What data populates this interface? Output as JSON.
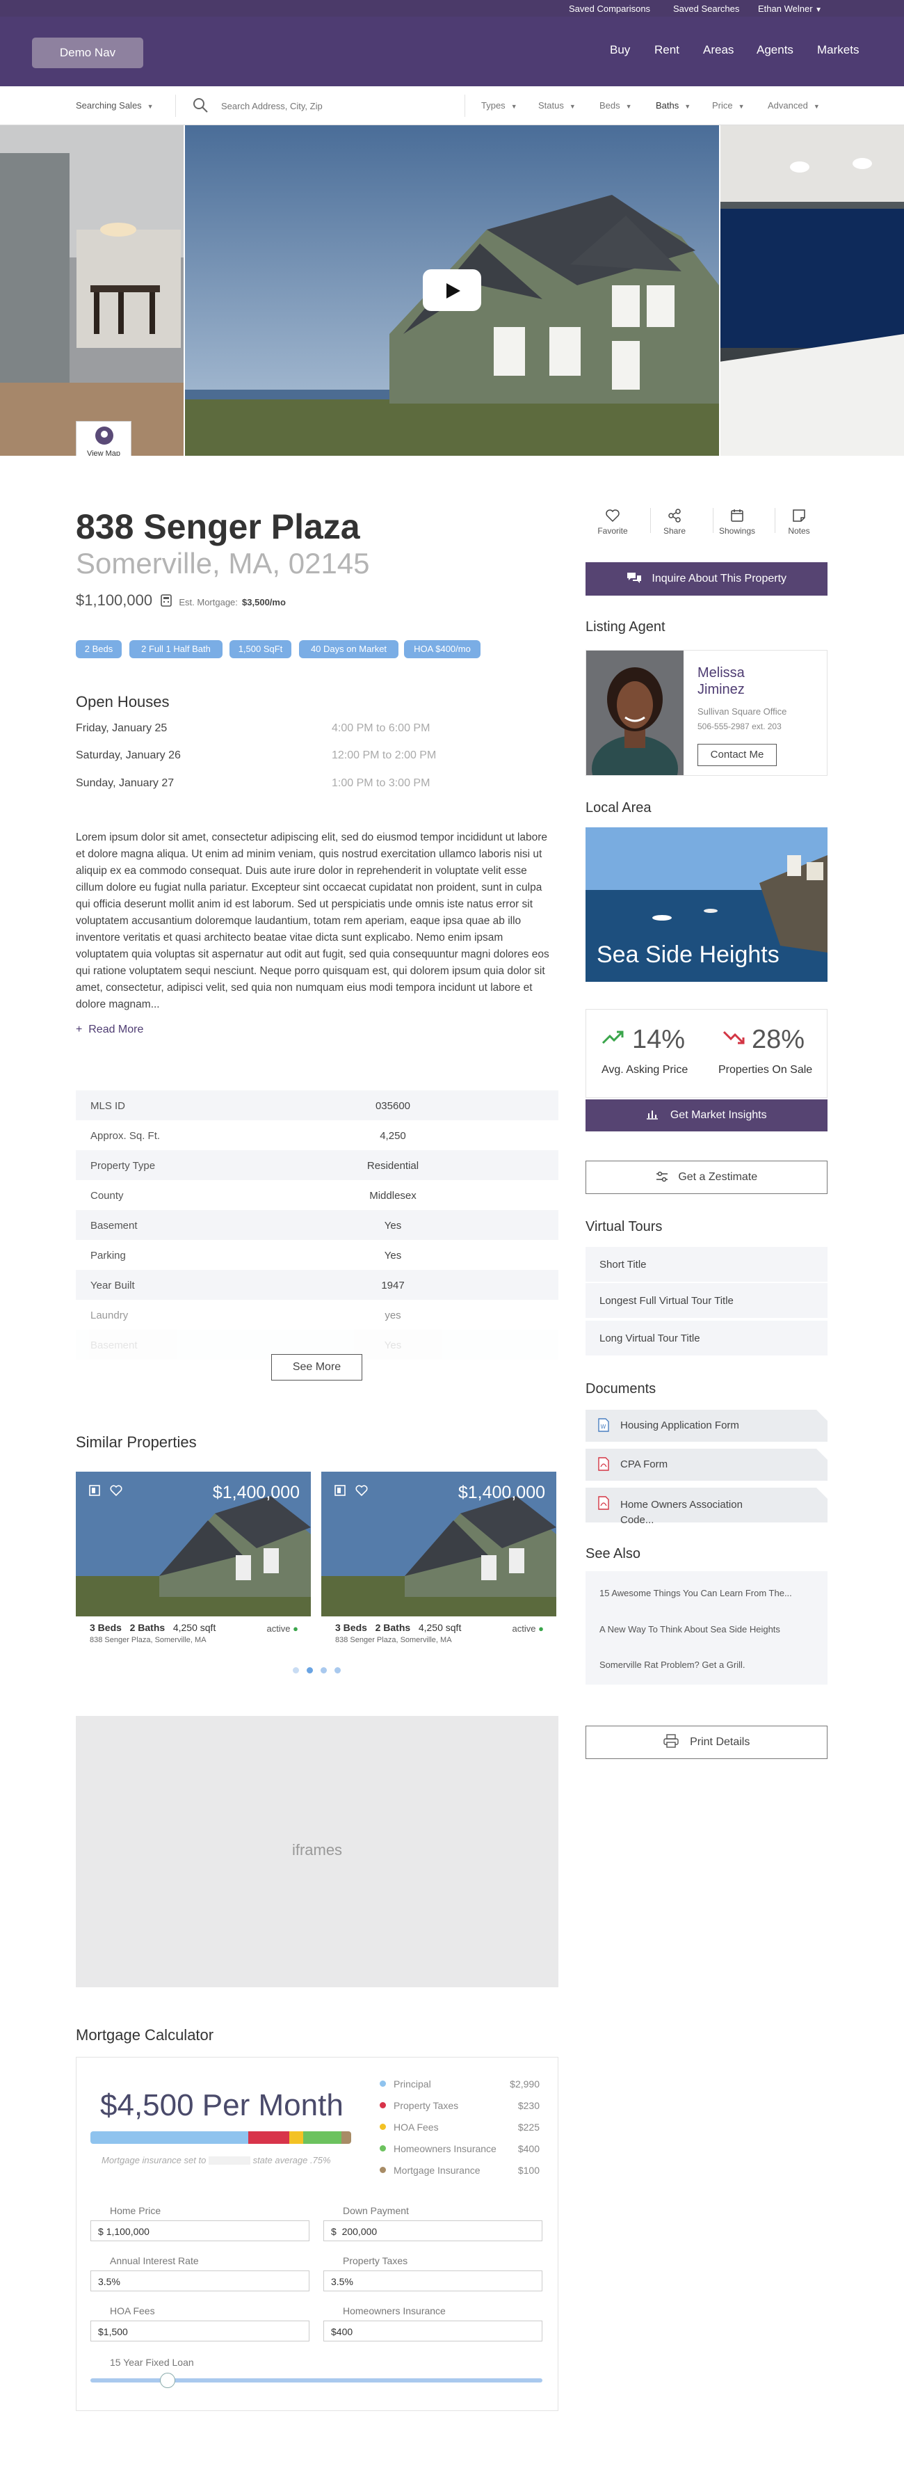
{
  "topbar": {
    "saved_comparisons": "Saved Comparisons",
    "saved_searches": "Saved Searches",
    "user": "Ethan Welner"
  },
  "nav": {
    "demo": "Demo Nav",
    "links": [
      "Buy",
      "Rent",
      "Areas",
      "Agents",
      "Markets"
    ]
  },
  "search": {
    "mode": "Searching Sales",
    "placeholder": "Search Address, City, Zip",
    "filters": [
      "Types",
      "Status",
      "Beds",
      "Baths",
      "Price",
      "Advanced"
    ]
  },
  "hero": {
    "view_map": "View Map"
  },
  "listing": {
    "address": "838 Senger Plaza",
    "location": "Somerville, MA, 02145",
    "price": "$1,100,000",
    "mortgage_label": "Est. Mortgage:",
    "mortgage_value": "$3,500/mo",
    "tags": [
      "2 Beds",
      "2 Full 1 Half Bath",
      "1,500 SqFt",
      "40 Days on Market",
      "HOA $400/mo"
    ]
  },
  "open_houses": {
    "title": "Open Houses",
    "items": [
      {
        "date": "Friday, January 25",
        "time": "4:00 PM to 6:00 PM"
      },
      {
        "date": "Saturday, January 26",
        "time": "12:00 PM to 2:00 PM"
      },
      {
        "date": "Sunday, January 27",
        "time": "1:00 PM to 3:00 PM"
      }
    ]
  },
  "description": "Lorem ipsum dolor sit amet, consectetur adipiscing elit, sed do eiusmod tempor incididunt ut labore et dolore magna aliqua. Ut enim ad minim veniam, quis nostrud exercitation ullamco laboris nisi ut aliquip ex ea commodo consequat. Duis aute irure dolor in reprehenderit in voluptate velit esse cillum dolore eu fugiat nulla pariatur. Excepteur sint occaecat cupidatat non proident, sunt in culpa qui officia deserunt mollit anim id est laborum. Sed ut perspiciatis unde omnis iste natus error sit voluptatem accusantium doloremque laudantium, totam rem aperiam, eaque ipsa quae ab illo inventore veritatis et quasi architecto beatae vitae dicta sunt explicabo. Nemo enim ipsam voluptatem quia voluptas sit aspernatur aut odit aut fugit, sed quia consequuntur magni dolores eos qui ratione voluptatem sequi nesciunt. Neque porro quisquam est, qui dolorem ipsum quia dolor sit amet, consectetur, adipisci velit, sed quia non numquam eius modi tempora incidunt ut labore et dolore magnam...",
  "read_more": "Read More",
  "facts": [
    {
      "k": "MLS ID",
      "v": "035600"
    },
    {
      "k": "Approx. Sq. Ft.",
      "v": "4,250"
    },
    {
      "k": "Property Type",
      "v": "Residential"
    },
    {
      "k": "County",
      "v": "Middlesex"
    },
    {
      "k": "Basement",
      "v": "Yes"
    },
    {
      "k": "Parking",
      "v": "Yes"
    },
    {
      "k": "Year Built",
      "v": "1947"
    },
    {
      "k": "Laundry",
      "v": "yes"
    },
    {
      "k": "Basement",
      "v": "Yes"
    }
  ],
  "see_more": "See More",
  "similar": {
    "title": "Similar Properties",
    "cards": [
      {
        "price": "$1,400,000",
        "beds": "3 Beds",
        "baths": "2 Baths",
        "sqft": "4,250 sqft",
        "status": "active",
        "address": "838 Senger Plaza, Somerville, MA"
      },
      {
        "price": "$1,400,000",
        "beds": "3 Beds",
        "baths": "2 Baths",
        "sqft": "4,250 sqft",
        "status": "active",
        "address": "838 Senger Plaza, Somerville, MA"
      }
    ]
  },
  "iframes": "iframes",
  "actions": [
    "Favorite",
    "Share",
    "Showings",
    "Notes"
  ],
  "inquire": "Inquire About This Property",
  "agent": {
    "title": "Listing Agent",
    "first": "Melissa",
    "last": "Jiminez",
    "office": "Sullivan Square Office",
    "phone": "506-555-2987 ext. 203",
    "contact": "Contact Me"
  },
  "local": {
    "title": "Local Area",
    "area": "Sea Side Heights",
    "asking_pct": "14%",
    "asking_label": "Avg. Asking Price",
    "sale_pct": "28%",
    "sale_label": "Properties On Sale",
    "insights": "Get Market Insights"
  },
  "zestimate": "Get a Zestimate",
  "tours": {
    "title": "Virtual Tours",
    "items": [
      "Short Title",
      "Longest Full Virtual Tour Title",
      "Long Virtual Tour Title"
    ]
  },
  "documents": {
    "title": "Documents",
    "items": [
      "Housing Application Form",
      "CPA Form",
      "Home Owners Association Code..."
    ]
  },
  "see_also": {
    "title": "See Also",
    "items": [
      "15 Awesome Things You Can Learn From The...",
      "A New Way To Think About Sea Side Heights",
      "Somerville Rat Problem? Get a Grill."
    ]
  },
  "print": "Print Details",
  "mortgage": {
    "title": "Mortgage Calculator",
    "monthly": "$4,500 Per Month",
    "note_pre": "Mortgage insurance set to",
    "note_post": "state average .75%",
    "breakdown": [
      {
        "label": "Principal",
        "value": "$2,990",
        "color": "#8fc3ee",
        "share": 0.66
      },
      {
        "label": "Property Taxes",
        "value": "$230",
        "color": "#d8344a",
        "share": 0.17
      },
      {
        "label": "HOA Fees",
        "value": "$225",
        "color": "#f3c224",
        "share": 0.06
      },
      {
        "label": "Homeowners Insurance",
        "value": "$400",
        "color": "#6cc25e",
        "share": 0.16
      },
      {
        "label": "Mortgage Insurance",
        "value": "$100",
        "color": "#a88c66",
        "share": 0.04
      }
    ],
    "fields": [
      {
        "label": "Home Price",
        "prefix": "$",
        "value": "1,100,000"
      },
      {
        "label": "Down Payment",
        "prefix": "$",
        "value": "200,000"
      },
      {
        "label": "Annual Interest Rate",
        "prefix": "",
        "value": "3.5%"
      },
      {
        "label": "Property Taxes",
        "prefix": "",
        "value": "3.5%"
      },
      {
        "label": "HOA Fees",
        "prefix": "",
        "value": "$1,500"
      },
      {
        "label": "Homeowners Insurance",
        "prefix": "",
        "value": "$400"
      }
    ],
    "loan_label": "15 Year Fixed Loan",
    "loan_level": 0.17
  },
  "colors": {
    "brand": "#4e3c72",
    "tag": "#7aade5",
    "up": "#3aa54b",
    "down": "#d33544"
  }
}
